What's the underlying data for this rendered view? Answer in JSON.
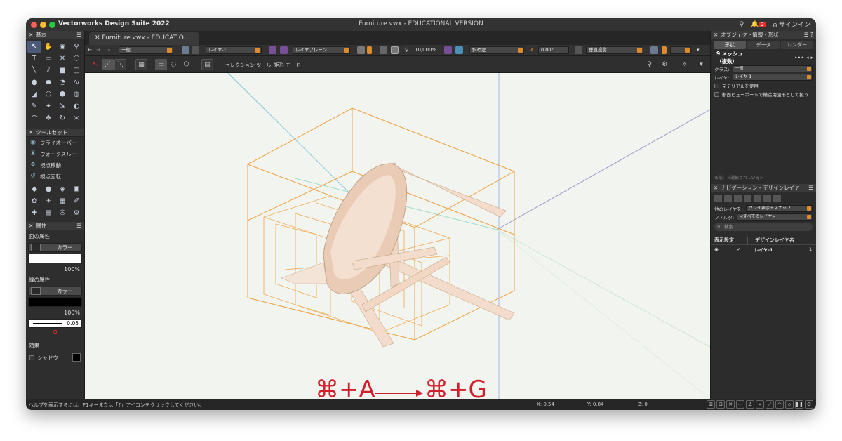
{
  "window": {
    "app_name": "Vectorworks Design Suite 2022",
    "document_title": "Furniture.vwx - EDUCATIONAL VERSION",
    "badge_count": "2",
    "signin_label": "サインイン"
  },
  "tab": {
    "label": "Furniture.vwx - EDUCATIO..."
  },
  "left_panels": {
    "basic": {
      "title": "基本"
    },
    "toolset": {
      "title": "ツールセット",
      "items": [
        "フライオーバー",
        "ウォークスルー",
        "視点移動",
        "視点回転"
      ]
    },
    "attributes": {
      "title": "属性",
      "fill_label": "面の属性",
      "fill_type": "カラー",
      "fill_opacity": "100%",
      "line_label": "線の属性",
      "line_type": "カラー",
      "line_opacity": "100%",
      "line_weight": "0.05",
      "effects_label": "効果",
      "shadow_label": "シャドウ"
    }
  },
  "view_bar": {
    "class": "一般",
    "layer": "レイヤ-1",
    "layer_plane": "レイヤプレーン",
    "zoom": "10,000%",
    "view": "斜め左",
    "angle": "0.00°",
    "projection": "垂直投影"
  },
  "mode_bar": {
    "label": "セレクション ツール: 矩形 モード"
  },
  "canvas": {
    "shortcut_from_key": "⌘+A",
    "shortcut_from_sub": "cmd",
    "shortcut_to_key": "⌘+G",
    "shortcut_to_sub": "cmd",
    "colors": {
      "bounding": "#f0a040",
      "chair": "#f3dccb",
      "annotation": "#d21f2c"
    }
  },
  "status_bar": {
    "help": "ヘルプを表示するには、F1キーまたは「?」アイコンをクリックしてください。",
    "x": "X: 0.54",
    "y": "Y: 0.84",
    "z": "Z: 0"
  },
  "object_info": {
    "title": "オブジェクト情報 - 形状",
    "tabs": [
      "形状",
      "データ",
      "レンダー"
    ],
    "object_name": "9 メッシュ（複数）",
    "class_label": "クラス:",
    "class_value": "一般",
    "layer_label": "レイヤ:",
    "layer_value": "レイヤ-1",
    "material_checkbox": "マテリアルを使用",
    "section_checkbox": "断面ビューポートで構造用図形として扱う",
    "name_label": "名前:",
    "name_placeholder": "<選択されている>"
  },
  "navigation": {
    "title": "ナビゲーション - デザインレイヤ",
    "other_layers_label": "他のレイヤを:",
    "other_layers_value": "グレイ表示＋スナップ",
    "filter_label": "フィルタ:",
    "filter_value": "<すべてのレイヤ>",
    "search_placeholder": "検索",
    "col_visibility": "表示設定",
    "col_name": "デザインレイヤ名",
    "row_layer_name": "レイヤ-1",
    "row_check": "✓",
    "row_number": "1"
  }
}
